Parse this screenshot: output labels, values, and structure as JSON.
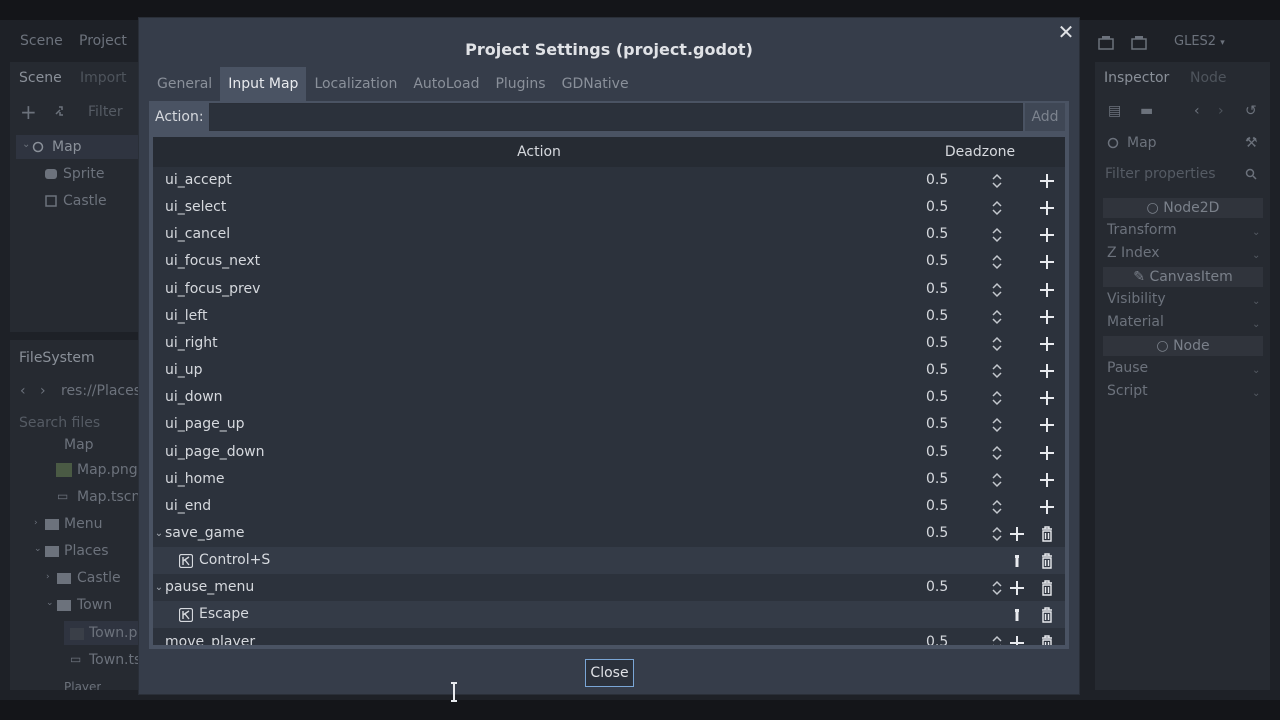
{
  "editor": {
    "menu": [
      "Scene",
      "Project"
    ],
    "renderer": "GLES2",
    "scene_tabs": [
      "Scene",
      "Import"
    ],
    "filter_placeholder": "Filter",
    "scene_tree": [
      {
        "label": "Map",
        "icon": "node2d-icon"
      },
      {
        "label": "Sprite",
        "icon": "sprite-icon"
      },
      {
        "label": "Castle",
        "icon": "instance-icon"
      }
    ],
    "filesystem": {
      "title": "FileSystem",
      "path": "res://Places",
      "search_placeholder": "Search files",
      "items": [
        "Map",
        "Map.png",
        "Map.tscn",
        "Menu",
        "Places",
        "Castle",
        "Town",
        "Town.png",
        "Town.tscn",
        "Player"
      ]
    },
    "inspector": {
      "tabs": [
        "Inspector",
        "Node"
      ],
      "node": "Map",
      "filter_placeholder": "Filter properties",
      "sections": [
        "Node2D",
        "Transform",
        "Z Index",
        "CanvasItem",
        "Visibility",
        "Material",
        "Node",
        "Pause",
        "Script"
      ]
    }
  },
  "dialog": {
    "title": "Project Settings (project.godot)",
    "tabs": [
      "General",
      "Input Map",
      "Localization",
      "AutoLoad",
      "Plugins",
      "GDNative"
    ],
    "active_tab": "Input Map",
    "action_label": "Action:",
    "action_value": "",
    "add_label": "Add",
    "columns": {
      "action": "Action",
      "deadzone": "Deadzone"
    },
    "rows": [
      {
        "name": "ui_accept",
        "deadzone": "0.5"
      },
      {
        "name": "ui_select",
        "deadzone": "0.5"
      },
      {
        "name": "ui_cancel",
        "deadzone": "0.5"
      },
      {
        "name": "ui_focus_next",
        "deadzone": "0.5"
      },
      {
        "name": "ui_focus_prev",
        "deadzone": "0.5"
      },
      {
        "name": "ui_left",
        "deadzone": "0.5"
      },
      {
        "name": "ui_right",
        "deadzone": "0.5"
      },
      {
        "name": "ui_up",
        "deadzone": "0.5"
      },
      {
        "name": "ui_down",
        "deadzone": "0.5"
      },
      {
        "name": "ui_page_up",
        "deadzone": "0.5"
      },
      {
        "name": "ui_page_down",
        "deadzone": "0.5"
      },
      {
        "name": "ui_home",
        "deadzone": "0.5"
      },
      {
        "name": "ui_end",
        "deadzone": "0.5"
      },
      {
        "name": "save_game",
        "deadzone": "0.5",
        "expanded": true
      },
      {
        "child_of": "save_game",
        "event": "Control+S"
      },
      {
        "name": "pause_menu",
        "deadzone": "0.5",
        "expanded": true
      },
      {
        "child_of": "pause_menu",
        "event": "Escape"
      },
      {
        "name": "move_player",
        "deadzone": "0.5"
      }
    ],
    "close_label": "Close"
  },
  "colors": {
    "dialog_bg": "#363d4a",
    "panel_bg": "#4a5363",
    "tree_bg": "#2c323c",
    "focus_border": "#7aa6d6",
    "text": "#d6d9de"
  }
}
